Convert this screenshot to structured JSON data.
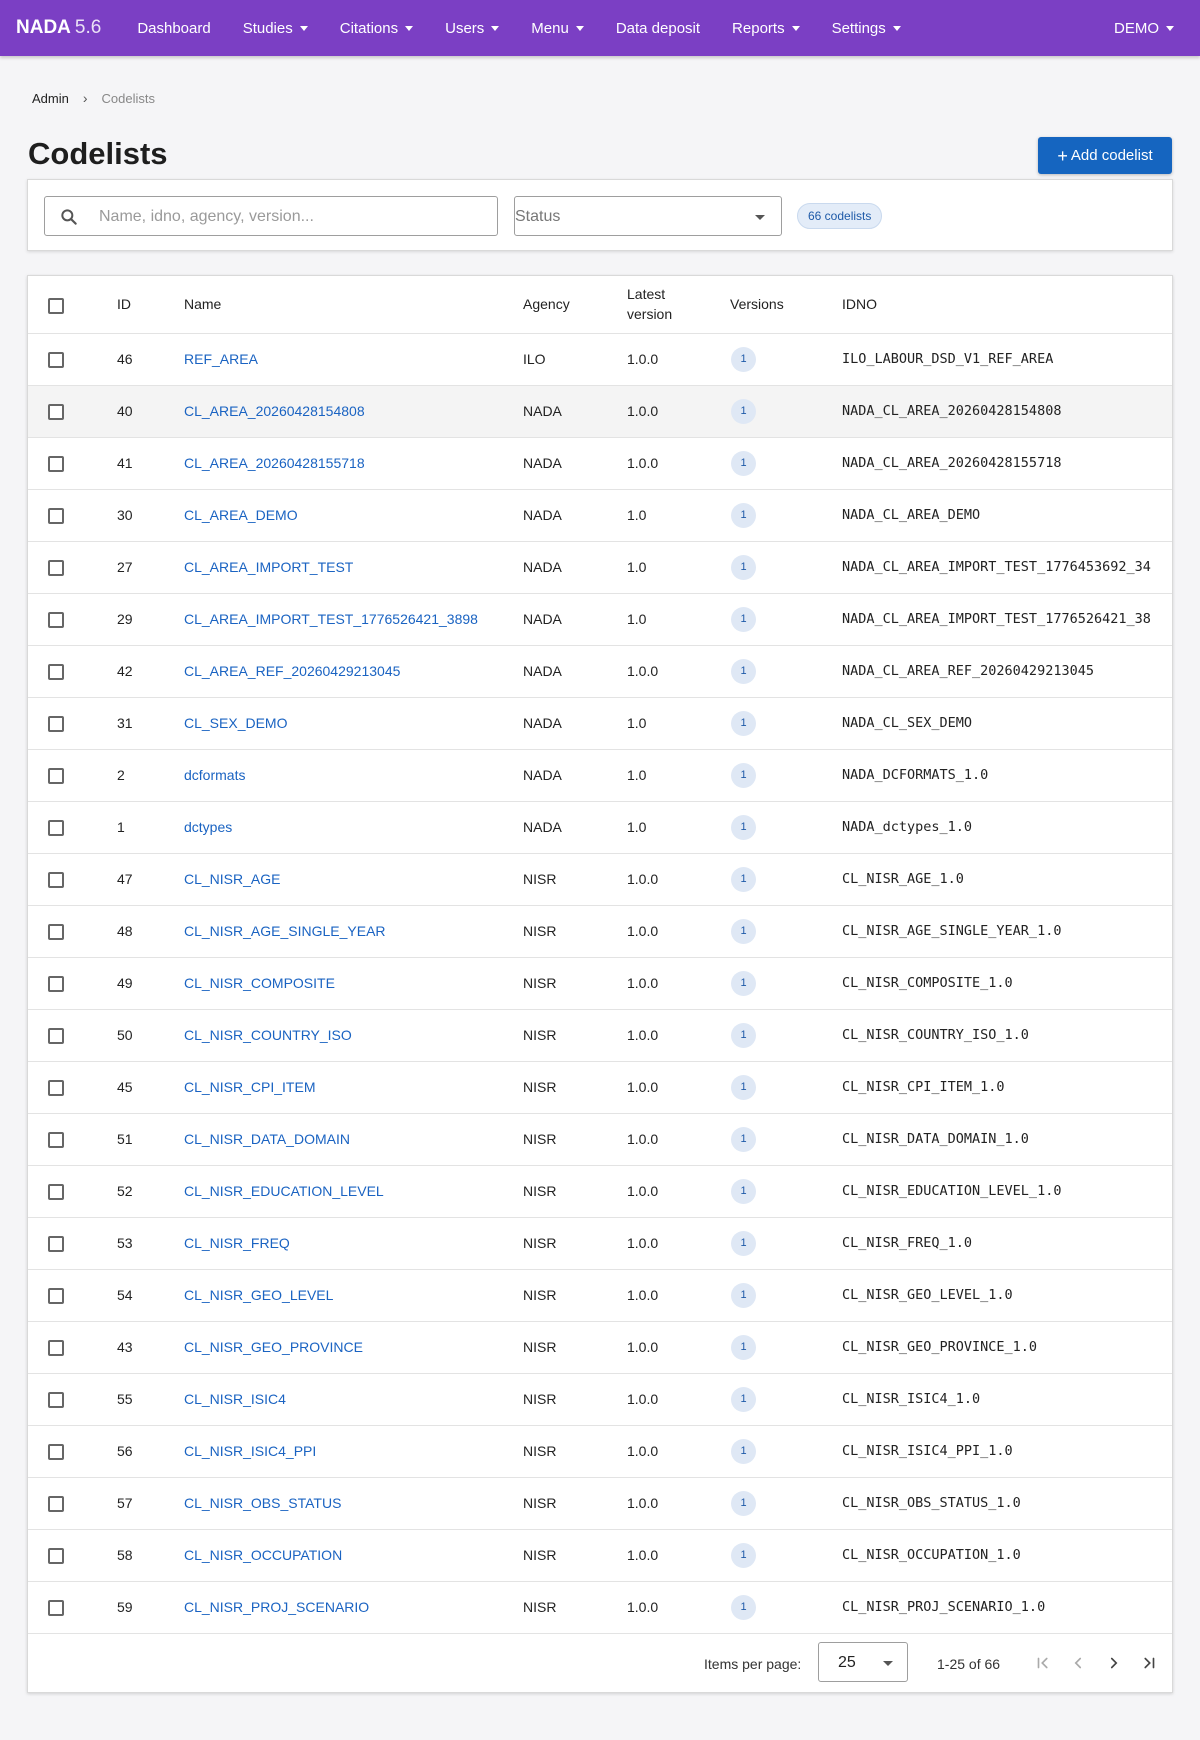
{
  "nav": {
    "brand": "NADA",
    "version": "5.6",
    "items": [
      {
        "label": "Dashboard",
        "dropdown": false
      },
      {
        "label": "Studies",
        "dropdown": true
      },
      {
        "label": "Citations",
        "dropdown": true
      },
      {
        "label": "Users",
        "dropdown": true
      },
      {
        "label": "Menu",
        "dropdown": true
      },
      {
        "label": "Data deposit",
        "dropdown": false
      },
      {
        "label": "Reports",
        "dropdown": true
      },
      {
        "label": "Settings",
        "dropdown": true
      }
    ],
    "user": "DEMO",
    "color": "#7b3fc4"
  },
  "breadcrumb": {
    "root": "Admin",
    "current": "Codelists"
  },
  "page": {
    "title": "Codelists",
    "add_button": "Add codelist"
  },
  "filters": {
    "search_placeholder": "Name, idno, agency, version...",
    "status_label": "Status",
    "count": "66 codelists"
  },
  "table": {
    "headers": {
      "id": "ID",
      "name": "Name",
      "agency": "Agency",
      "latest_version": "Latest version",
      "versions": "Versions",
      "idno": "IDNO"
    },
    "rows": [
      {
        "id": "46",
        "name": "REF_AREA",
        "agency": "ILO",
        "version": "1.0.0",
        "versions": "1",
        "idno": "ILO_LABOUR_DSD_V1_REF_AREA"
      },
      {
        "id": "40",
        "name": "CL_AREA_20260428154808",
        "agency": "NADA",
        "version": "1.0.0",
        "versions": "1",
        "idno": "NADA_CL_AREA_20260428154808"
      },
      {
        "id": "41",
        "name": "CL_AREA_20260428155718",
        "agency": "NADA",
        "version": "1.0.0",
        "versions": "1",
        "idno": "NADA_CL_AREA_20260428155718"
      },
      {
        "id": "30",
        "name": "CL_AREA_DEMO",
        "agency": "NADA",
        "version": "1.0",
        "versions": "1",
        "idno": "NADA_CL_AREA_DEMO"
      },
      {
        "id": "27",
        "name": "CL_AREA_IMPORT_TEST",
        "agency": "NADA",
        "version": "1.0",
        "versions": "1",
        "idno": "NADA_CL_AREA_IMPORT_TEST_1776453692_34"
      },
      {
        "id": "29",
        "name": "CL_AREA_IMPORT_TEST_1776526421_3898",
        "agency": "NADA",
        "version": "1.0",
        "versions": "1",
        "idno": "NADA_CL_AREA_IMPORT_TEST_1776526421_38"
      },
      {
        "id": "42",
        "name": "CL_AREA_REF_20260429213045",
        "agency": "NADA",
        "version": "1.0.0",
        "versions": "1",
        "idno": "NADA_CL_AREA_REF_20260429213045"
      },
      {
        "id": "31",
        "name": "CL_SEX_DEMO",
        "agency": "NADA",
        "version": "1.0",
        "versions": "1",
        "idno": "NADA_CL_SEX_DEMO"
      },
      {
        "id": "2",
        "name": "dcformats",
        "agency": "NADA",
        "version": "1.0",
        "versions": "1",
        "idno": "NADA_DCFORMATS_1.0"
      },
      {
        "id": "1",
        "name": "dctypes",
        "agency": "NADA",
        "version": "1.0",
        "versions": "1",
        "idno": "NADA_dctypes_1.0"
      },
      {
        "id": "47",
        "name": "CL_NISR_AGE",
        "agency": "NISR",
        "version": "1.0.0",
        "versions": "1",
        "idno": "CL_NISR_AGE_1.0"
      },
      {
        "id": "48",
        "name": "CL_NISR_AGE_SINGLE_YEAR",
        "agency": "NISR",
        "version": "1.0.0",
        "versions": "1",
        "idno": "CL_NISR_AGE_SINGLE_YEAR_1.0"
      },
      {
        "id": "49",
        "name": "CL_NISR_COMPOSITE",
        "agency": "NISR",
        "version": "1.0.0",
        "versions": "1",
        "idno": "CL_NISR_COMPOSITE_1.0"
      },
      {
        "id": "50",
        "name": "CL_NISR_COUNTRY_ISO",
        "agency": "NISR",
        "version": "1.0.0",
        "versions": "1",
        "idno": "CL_NISR_COUNTRY_ISO_1.0"
      },
      {
        "id": "45",
        "name": "CL_NISR_CPI_ITEM",
        "agency": "NISR",
        "version": "1.0.0",
        "versions": "1",
        "idno": "CL_NISR_CPI_ITEM_1.0"
      },
      {
        "id": "51",
        "name": "CL_NISR_DATA_DOMAIN",
        "agency": "NISR",
        "version": "1.0.0",
        "versions": "1",
        "idno": "CL_NISR_DATA_DOMAIN_1.0"
      },
      {
        "id": "52",
        "name": "CL_NISR_EDUCATION_LEVEL",
        "agency": "NISR",
        "version": "1.0.0",
        "versions": "1",
        "idno": "CL_NISR_EDUCATION_LEVEL_1.0"
      },
      {
        "id": "53",
        "name": "CL_NISR_FREQ",
        "agency": "NISR",
        "version": "1.0.0",
        "versions": "1",
        "idno": "CL_NISR_FREQ_1.0"
      },
      {
        "id": "54",
        "name": "CL_NISR_GEO_LEVEL",
        "agency": "NISR",
        "version": "1.0.0",
        "versions": "1",
        "idno": "CL_NISR_GEO_LEVEL_1.0"
      },
      {
        "id": "43",
        "name": "CL_NISR_GEO_PROVINCE",
        "agency": "NISR",
        "version": "1.0.0",
        "versions": "1",
        "idno": "CL_NISR_GEO_PROVINCE_1.0"
      },
      {
        "id": "55",
        "name": "CL_NISR_ISIC4",
        "agency": "NISR",
        "version": "1.0.0",
        "versions": "1",
        "idno": "CL_NISR_ISIC4_1.0"
      },
      {
        "id": "56",
        "name": "CL_NISR_ISIC4_PPI",
        "agency": "NISR",
        "version": "1.0.0",
        "versions": "1",
        "idno": "CL_NISR_ISIC4_PPI_1.0"
      },
      {
        "id": "57",
        "name": "CL_NISR_OBS_STATUS",
        "agency": "NISR",
        "version": "1.0.0",
        "versions": "1",
        "idno": "CL_NISR_OBS_STATUS_1.0"
      },
      {
        "id": "58",
        "name": "CL_NISR_OCCUPATION",
        "agency": "NISR",
        "version": "1.0.0",
        "versions": "1",
        "idno": "CL_NISR_OCCUPATION_1.0"
      },
      {
        "id": "59",
        "name": "CL_NISR_PROJ_SCENARIO",
        "agency": "NISR",
        "version": "1.0.0",
        "versions": "1",
        "idno": "CL_NISR_PROJ_SCENARIO_1.0"
      }
    ]
  },
  "pagination": {
    "items_per_page_label": "Items per page:",
    "items_per_page": "25",
    "range": "1-25 of 66"
  },
  "colors": {
    "primary": "#1565c0",
    "link": "#1a63c2",
    "badge_bg": "#dfe8f5"
  }
}
